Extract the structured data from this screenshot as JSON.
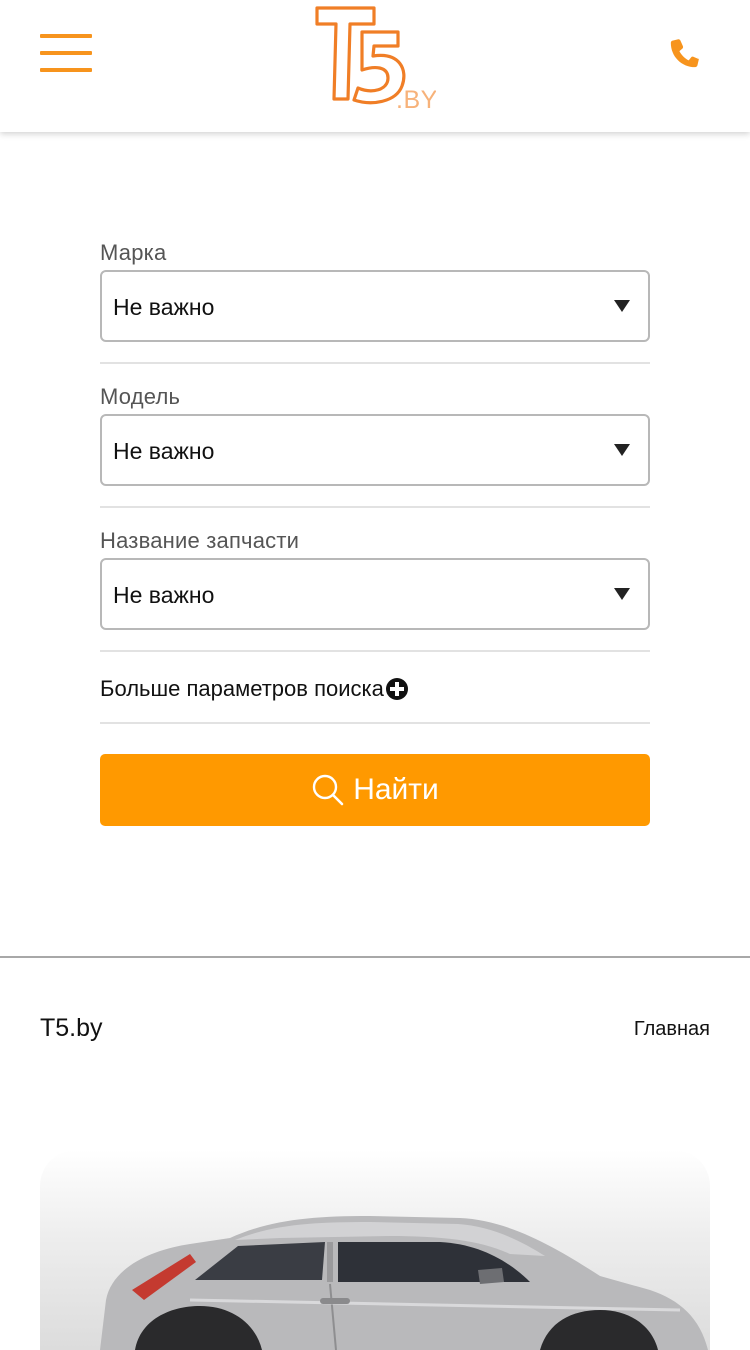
{
  "header": {
    "logo_main": "T5",
    "logo_suffix": ".BY",
    "accent_color": "#f7941d",
    "menu_icon": "hamburger-menu-icon",
    "phone_icon": "phone-icon"
  },
  "search_form": {
    "fields": [
      {
        "label": "Марка",
        "value": "Не важно"
      },
      {
        "label": "Модель",
        "value": "Не важно"
      },
      {
        "label": "Название запчасти",
        "value": "Не важно"
      }
    ],
    "more_params_label": "Больше параметров поиска",
    "more_params_icon": "plus-circle-icon",
    "search_button": {
      "label": "Найти",
      "icon": "search-icon",
      "color": "#ff9900"
    }
  },
  "footer": {
    "brand": "T5.by",
    "home_link": "Главная"
  },
  "banner": {
    "image": "silver-hatchback-car"
  }
}
